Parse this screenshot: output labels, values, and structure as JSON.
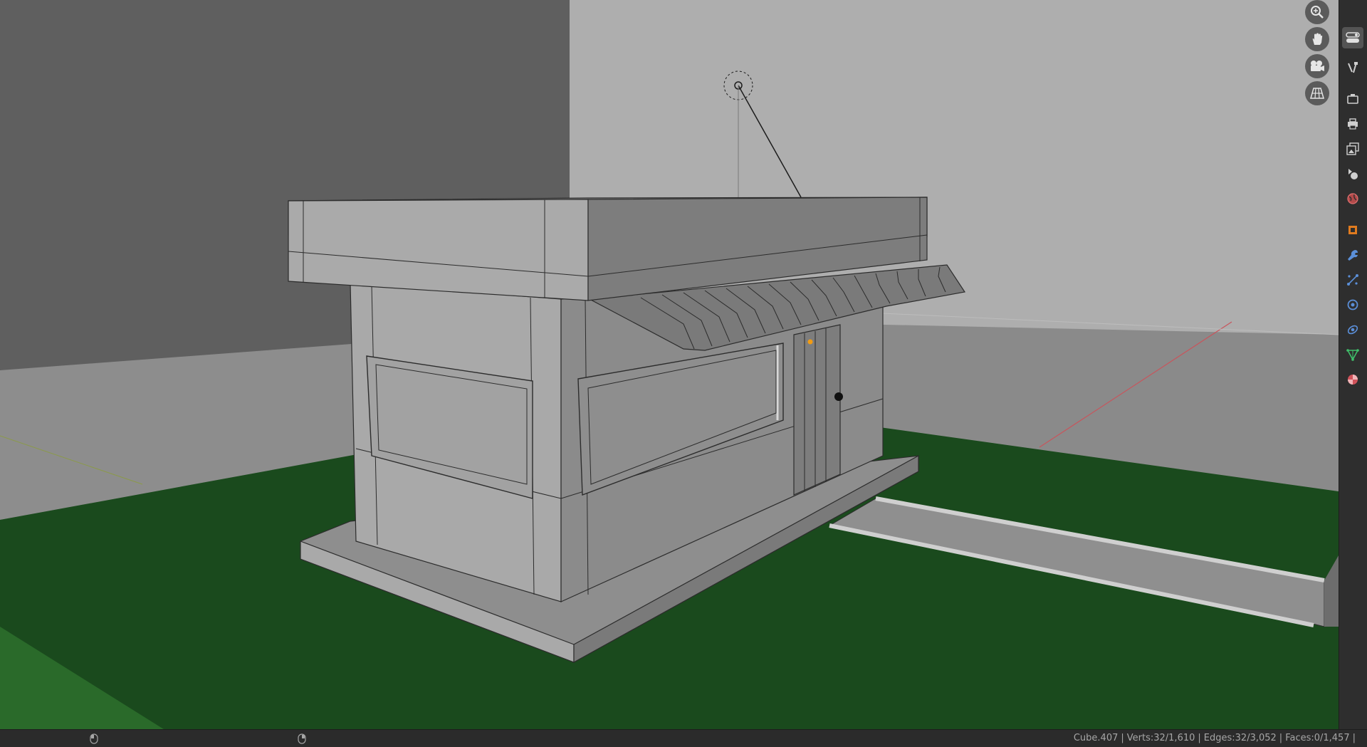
{
  "app": "Blender",
  "viewport": {
    "navigation": {
      "zoom_icon": "zoom-in-icon",
      "pan_icon": "hand-icon",
      "camera_icon": "camera-icon",
      "ortho_icon": "grid-icon"
    },
    "colors": {
      "ground": "#1a4a1d",
      "wall_dark": "#5f5f5f",
      "wall_light": "#aeaeae",
      "mesh": "#a3a3a3",
      "accent_orange": "#f39c12",
      "x_axis": "#c8555c"
    }
  },
  "properties_tabs": [
    {
      "name": "tool",
      "icon": "toggle-icon",
      "active": true
    },
    {
      "name": "tool-settings",
      "icon": "tools-icon"
    },
    {
      "name": "render",
      "icon": "camera-back-icon"
    },
    {
      "name": "output",
      "icon": "printer-icon"
    },
    {
      "name": "view-layer",
      "icon": "image-stack-icon"
    },
    {
      "name": "scene",
      "icon": "scene-icon"
    },
    {
      "name": "world",
      "icon": "world-icon"
    },
    {
      "name": "object",
      "icon": "object-square-icon"
    },
    {
      "name": "modifiers",
      "icon": "wrench-icon"
    },
    {
      "name": "particles",
      "icon": "particles-icon"
    },
    {
      "name": "physics",
      "icon": "physics-icon"
    },
    {
      "name": "constraints",
      "icon": "constraint-icon"
    },
    {
      "name": "data",
      "icon": "mesh-data-icon"
    },
    {
      "name": "material",
      "icon": "material-sphere-icon"
    }
  ],
  "status_bar": {
    "object": "Cube.407",
    "verts": "Verts:32/1,610",
    "edges": "Edges:32/3,052",
    "faces": "Faces:0/1,457",
    "separator": "|"
  }
}
